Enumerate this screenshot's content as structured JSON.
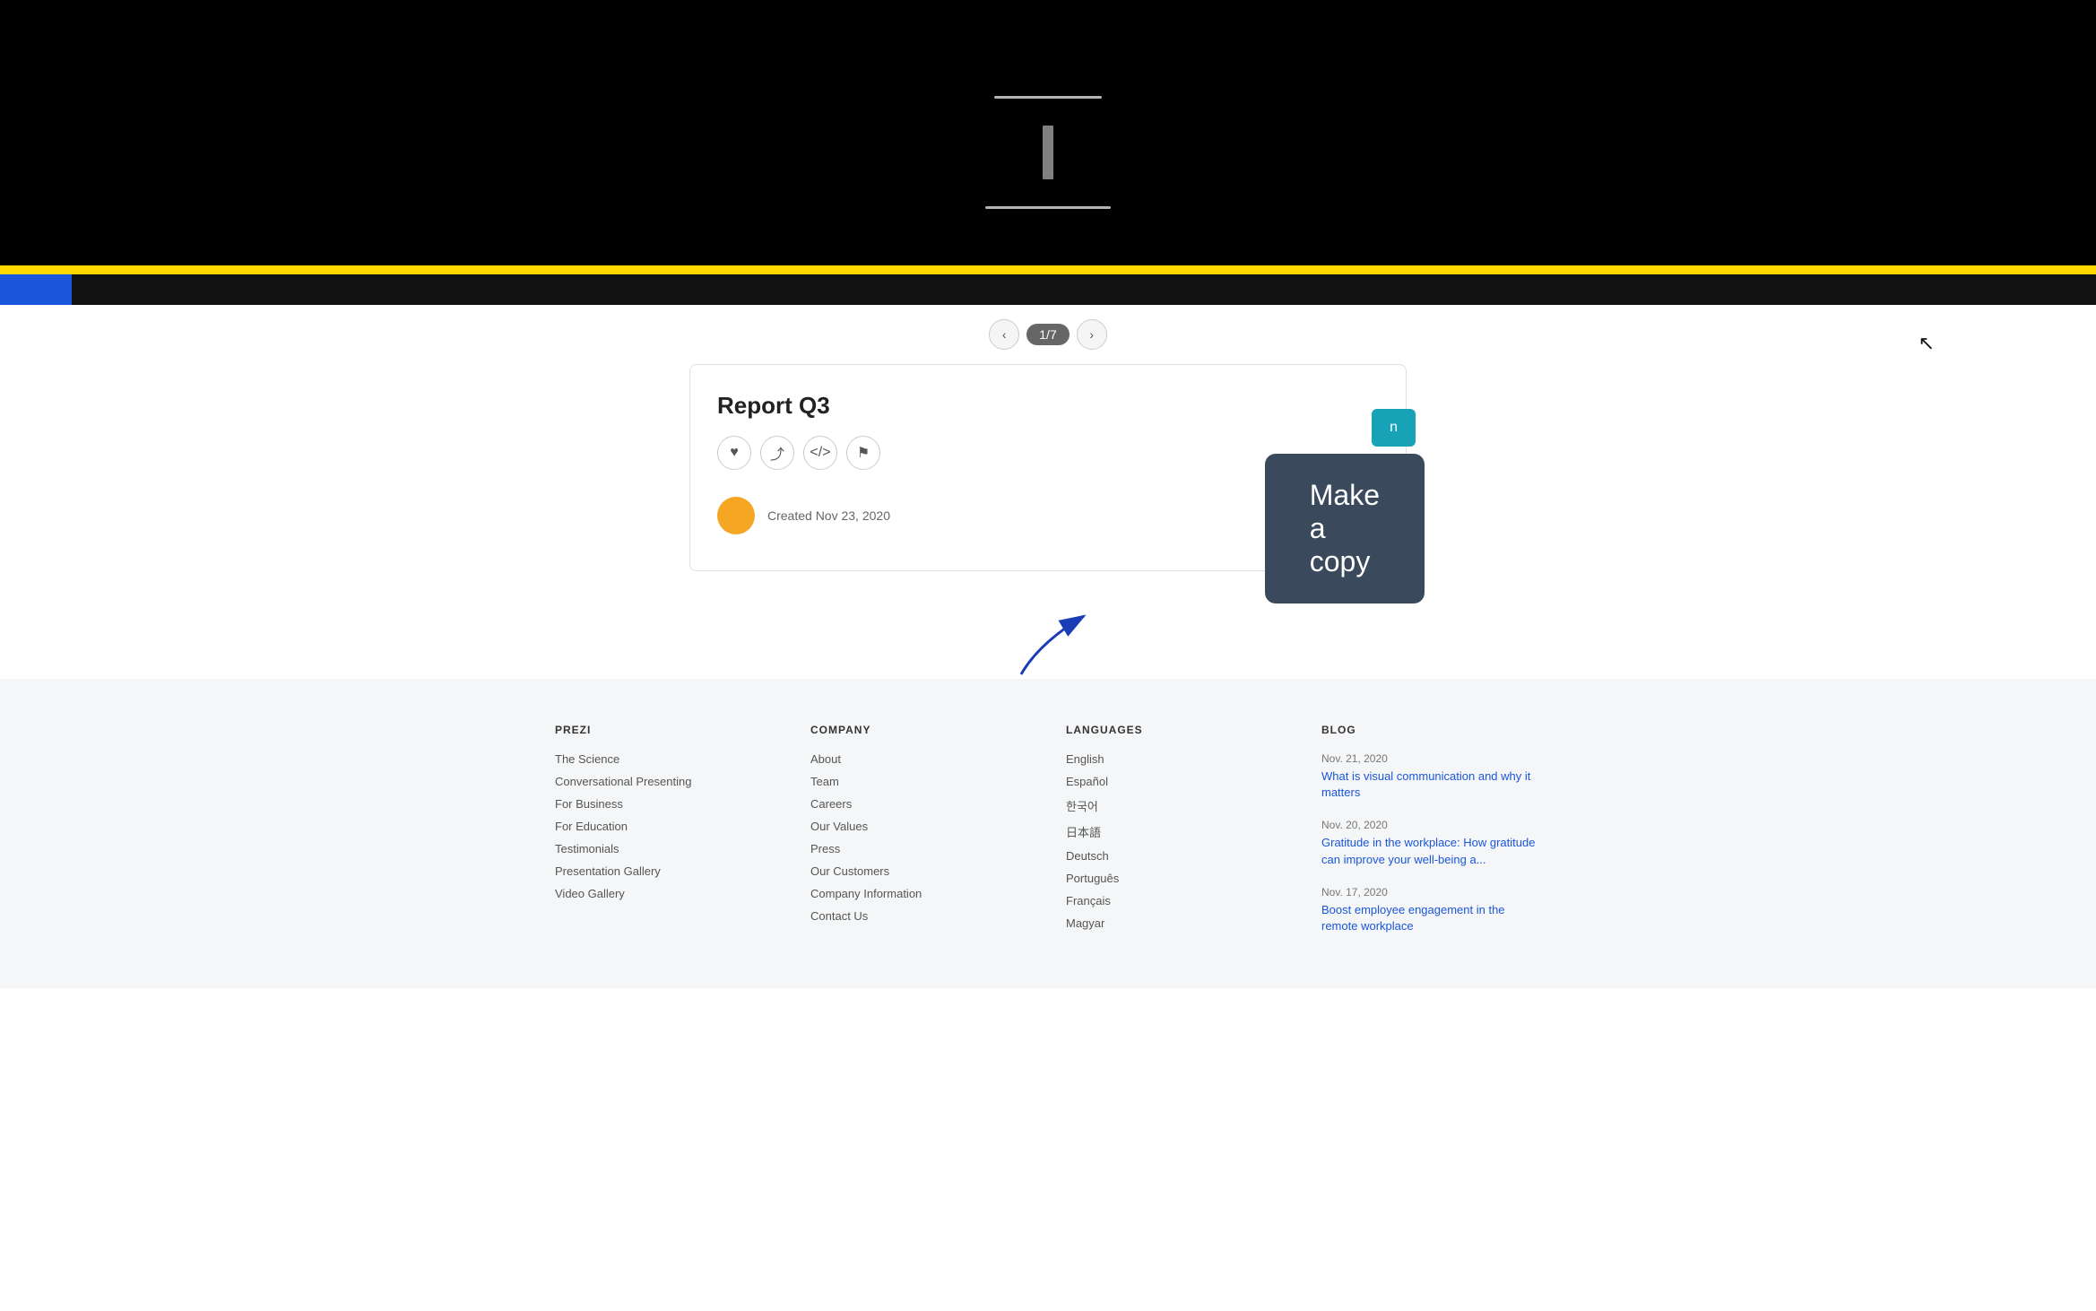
{
  "viewer": {
    "slide_count": "1/7",
    "prev_label": "‹",
    "next_label": "›"
  },
  "card": {
    "title": "Report Q3",
    "created_label": "Created Nov 23, 2020",
    "make_copy_label": "Make a copy",
    "action_like": "♥",
    "action_share": "⤴",
    "action_embed": "</>",
    "action_flag": "⚑"
  },
  "footer": {
    "prezi": {
      "title": "PREZI",
      "links": [
        "The Science",
        "Conversational Presenting",
        "For Business",
        "For Education",
        "Testimonials",
        "Presentation Gallery",
        "Video Gallery"
      ]
    },
    "company": {
      "title": "COMPANY",
      "links": [
        "About",
        "Team",
        "Careers",
        "Our Values",
        "Press",
        "Our Customers",
        "Company Information",
        "Contact Us"
      ]
    },
    "languages": {
      "title": "LANGUAGES",
      "links": [
        "English",
        "Español",
        "한국어",
        "日本語",
        "Deutsch",
        "Português",
        "Français",
        "Magyar"
      ]
    },
    "blog": {
      "title": "BLOG",
      "entries": [
        {
          "date": "Nov. 21, 2020",
          "text": "What is visual communication and why it matters"
        },
        {
          "date": "Nov. 20, 2020",
          "text": "Gratitude in the workplace: How gratitude can improve your well-being a..."
        },
        {
          "date": "Nov. 17, 2020",
          "text": "Boost employee engagement in the remote workplace"
        }
      ]
    }
  }
}
